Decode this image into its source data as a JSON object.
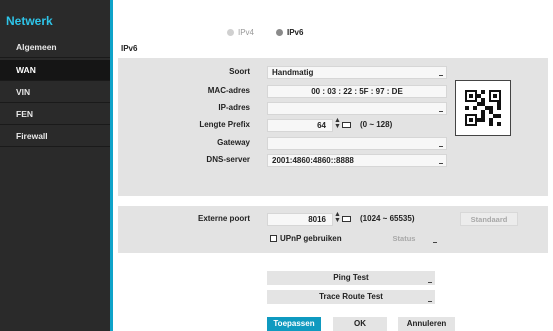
{
  "sidebar": {
    "title": "Netwerk",
    "items": [
      {
        "label": "Algemeen",
        "active": false
      },
      {
        "label": "WAN",
        "active": true
      },
      {
        "label": "VIN",
        "active": false
      },
      {
        "label": "FEN",
        "active": false
      },
      {
        "label": "Firewall",
        "active": false
      }
    ]
  },
  "protocol": {
    "options": [
      "IPv4",
      "IPv6"
    ],
    "selected": "IPv6"
  },
  "section_title": "IPv6",
  "form": {
    "soort_label": "Soort",
    "soort_value": "Handmatig",
    "mac_label": "MAC-adres",
    "mac_value": "00 : 03 : 22 : 5F : 97 : DE",
    "ip_label": "IP-adres",
    "ip_value": "",
    "prefix_label": "Lengte Prefix",
    "prefix_value": "64",
    "prefix_range": "(0 ~ 128)",
    "gateway_label": "Gateway",
    "gateway_value": "",
    "dns_label": "DNS-server",
    "dns_value": "2001:4860:4860::8888"
  },
  "port": {
    "label": "Externe poort",
    "value": "8016",
    "range": "(1024 ~ 65535)",
    "standard_button": "Standaard",
    "upnp_label": "UPnP gebruiken",
    "status_button": "Status"
  },
  "tests": {
    "ping": "Ping Test",
    "trace": "Trace Route Test"
  },
  "footer": {
    "apply": "Toepassen",
    "ok": "OK",
    "cancel": "Annuleren"
  },
  "colors": {
    "accent": "#0f9ac0",
    "sidebar_title": "#2ec4e8"
  }
}
